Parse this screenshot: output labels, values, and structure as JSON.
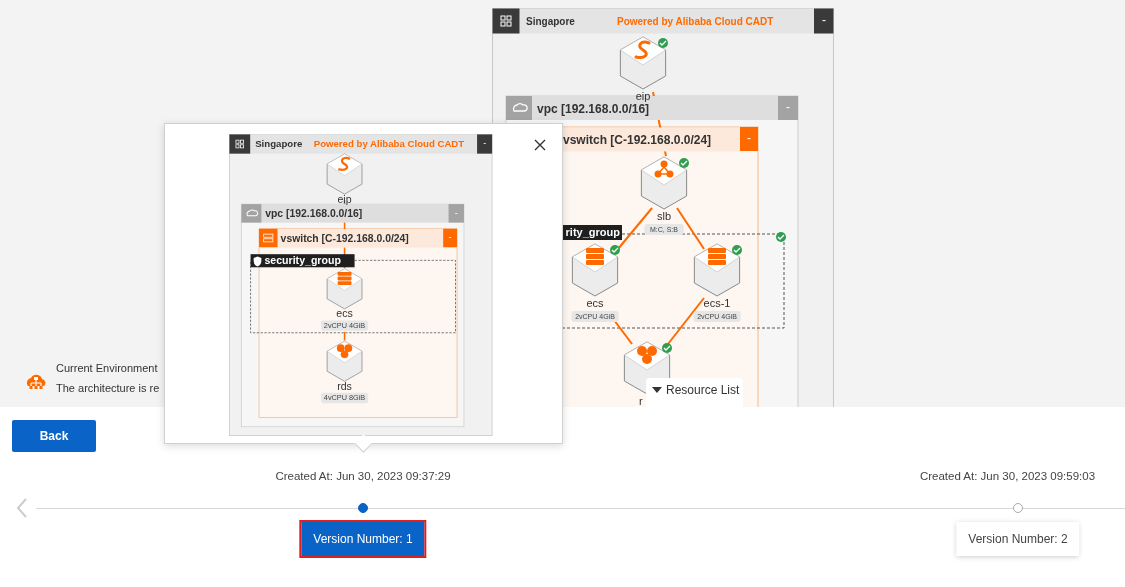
{
  "current_diagram": {
    "region": {
      "name": "Singapore",
      "toggle": "-"
    },
    "brand": "Powered by Alibaba Cloud CADT",
    "vpc": {
      "label": "vpc [192.168.0.0/16]",
      "toggle": "-"
    },
    "vswitch": {
      "label": "vswitch [C-192.168.0.0/24]",
      "toggle": "-"
    },
    "security_group": {
      "label": "rity_group",
      "healthy": true
    },
    "nodes": [
      {
        "kind": "eip",
        "label": "eip",
        "healthy": true
      },
      {
        "kind": "slb",
        "label": "slb",
        "healthy": true,
        "tags": [
          "M:C, S:B"
        ]
      },
      {
        "kind": "ecs",
        "label": "ecs",
        "healthy": true,
        "tags": [
          "2vCPU 4GiB"
        ]
      },
      {
        "kind": "ecs",
        "label": "ecs-1",
        "healthy": true,
        "tags": [
          "2vCPU 4GiB"
        ]
      },
      {
        "kind": "rds",
        "label": "r",
        "healthy": true
      }
    ]
  },
  "environment": {
    "title": "Current Environment",
    "message": "The architecture is re"
  },
  "resource_list": {
    "label": "Resource List"
  },
  "preview": {
    "region": {
      "name": "Singapore",
      "toggle": "-"
    },
    "brand": "Powered by Alibaba Cloud CADT",
    "vpc": {
      "label": "vpc [192.168.0.0/16]",
      "toggle": "-"
    },
    "vswitch": {
      "label": "vswitch [C-192.168.0.0/24]",
      "toggle": "-"
    },
    "security_group": {
      "label": "security_group"
    },
    "nodes": [
      {
        "kind": "eip",
        "label": "eip"
      },
      {
        "kind": "ecs",
        "label": "ecs",
        "tags": [
          "2vCPU 4GiB"
        ]
      },
      {
        "kind": "rds",
        "label": "rds",
        "tags": [
          "4vCPU 8GiB"
        ]
      }
    ]
  },
  "back_button": "Back",
  "versions": [
    {
      "created": "Created At: Jun 30, 2023 09:37:29",
      "label": "Version Number: 1",
      "selected": true
    },
    {
      "created": "Created At: Jun 30, 2023 09:59:03",
      "label": "Version Number: 2",
      "selected": false
    }
  ]
}
